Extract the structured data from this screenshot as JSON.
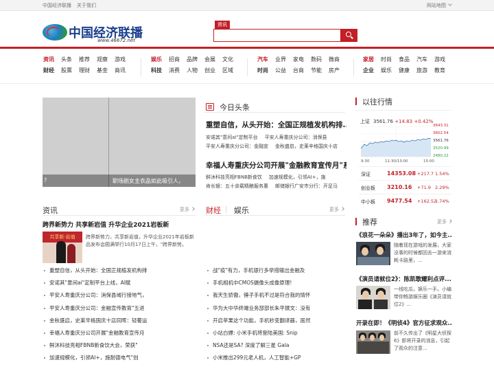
{
  "topbar": {
    "links": [
      "中国经济联播",
      "关于我们"
    ],
    "sitemap": "网站地图"
  },
  "logo": {
    "text": "中国经济联播",
    "url": "www.46672.net"
  },
  "search": {
    "tag": "资讯",
    "value": "",
    "placeholder": ""
  },
  "nav": [
    {
      "rows": [
        [
          "资讯",
          "头条",
          "推荐",
          "观察",
          "游戏"
        ],
        [
          "财经",
          "股票",
          "理财",
          "基金",
          "商讯"
        ]
      ]
    },
    {
      "rows": [
        [
          "娱乐",
          "招商",
          "品牌",
          "会展",
          "文化"
        ],
        [
          "科技",
          "消费",
          "人物",
          "创业",
          "区域"
        ]
      ]
    },
    {
      "rows": [
        [
          "汽车",
          "业界",
          "家电",
          "数码",
          "微商"
        ],
        [
          "时尚",
          "公益",
          "台商",
          "节能",
          "房产"
        ]
      ]
    },
    {
      "rows": [
        [
          "家居",
          "时尚",
          "食品",
          "汽车",
          "游戏"
        ],
        [
          "企业",
          "娱乐",
          "健康",
          "旅游",
          "教育"
        ]
      ]
    }
  ],
  "slider": {
    "caption_left": "?",
    "caption_right": "职场剧女主衣品如此吸引人，"
  },
  "toutiao": {
    "title": "今日头条",
    "items": [
      {
        "headline": "重塑自信，从头开始：全国正规植发机构排...",
        "subs": [
          [
            "安诺其\"意间ai\"定制平台",
            "平安人寿重庆分公司：消保县"
          ],
          [
            "平安人寿重庆分公司：金融宣",
            "金秋盛启，史莱辛格国庆十店"
          ]
        ]
      },
      {
        "headline": "幸福人寿重庆分公司开展\"金融教育宣传月\"系",
        "subs": [
          [
            "鲜沐科技亮相FBNB新食饮",
            "加速规模化，引领AI+，施"
          ],
          [
            "肯长银：五十余载精酿服务惠",
            "邮储银行广安市分行：开足马"
          ]
        ]
      }
    ]
  },
  "zixun": {
    "title": "资讯",
    "more": "更多",
    "feature_title": "跨界新势力 共享新岩值 升华企业2021岩板新",
    "feature_banner": "共享新·岩值",
    "feature_text": "跨界新势力，共享新岩值，升华企业2021年岩板新品发布会圆满举行10月17日上午，\"跨界新势。",
    "list": [
      "重塑自信，从头开始：全国正规植发机构排",
      "安诺其\"意间ai\"定制平台上线，AI赋",
      "平安人寿重庆分公司：消保县域行接地气，",
      "平安人寿重庆分公司：金融宣传教育\"五进",
      "金秋盛启，史莱辛格国庆十店同晖：轻奢运",
      "幸福人寿重庆分公司开展\"金融教育宣传月",
      "鲜沐科技亮相FBNB新食饮大会，荣获\"",
      "加速规模化，引领AI+，施耐德电气\"创"
    ]
  },
  "caijing": {
    "tabs": [
      "财经",
      "娱乐"
    ],
    "more": "更多",
    "list": [
      "战\"疫\"有力，手机银行多举措输出金融及",
      "手机相机中CMOS摄像头成像原理!",
      "我天生骄傲，锤子手机不过是符合我的情怀",
      "华为大中华终端业务部部长朱平撰文：没有",
      "开启苹果这个功能，手机秒变翻译器，居然",
      "小站白嫖: 小米手机将登陆美国: Snip",
      "NSA还是SA? 深度了解三星 Gala",
      "小米推出299元老人机，人工智能+GP"
    ]
  },
  "market": {
    "title": "以往行情",
    "index_label": "上证",
    "index_value": "3561.76",
    "index_change": "+14.83",
    "index_pct": "+0.42%",
    "y_ticks": [
      "3643.31",
      "3602.54",
      "3561.76",
      "3520.99",
      "2480.22"
    ],
    "x_ticks": [
      "9:30",
      "11:30/13:00",
      "15:00"
    ],
    "rows": [
      {
        "name": "深证",
        "price": "14353.08",
        "change": "+217.7",
        "pct": "1.54%"
      },
      {
        "name": "创业板",
        "price": "3210.16",
        "change": "+71.9",
        "pct": "2.29%"
      },
      {
        "name": "中小板",
        "price": "9477.54",
        "change": "+162.52",
        "pct": "1.74%"
      }
    ]
  },
  "recommend": {
    "title": "推荐",
    "more": "更多",
    "items": [
      {
        "title": "《浪花一朵朵》播出3年了，如今主...",
        "text": "随着现在游戏的发展，大家没事的时候都回去一游来消耗卡路里，..."
      },
      {
        "title": "《演员请就位2》：陈凯歌耀利点评...",
        "text": "一线吃瓜，娱乐一手。小编带你畅游娱乐圈《演员请就位2》..."
      },
      {
        "title": "开录在即！《明侦4》官方征求观众...",
        "text": "前不久传出了《明星大侦探6》即将开录的消息，引起了观众的注意..."
      }
    ]
  }
}
